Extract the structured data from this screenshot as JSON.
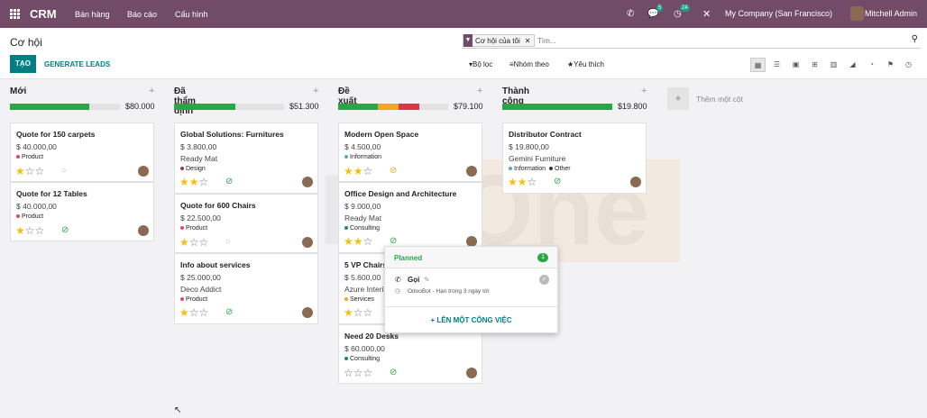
{
  "topbar": {
    "app_name": "CRM",
    "menus": [
      "Bán hàng",
      "Báo cáo",
      "Cấu hình"
    ],
    "messages_count": "5",
    "activities_count": "24",
    "company": "My Company (San Francisco)",
    "user": "Mitchell Admin"
  },
  "control": {
    "title": "Cơ hội",
    "create_label": "TẠO",
    "generate_label": "GENERATE LEADS",
    "facet_label": "Cơ hội của tôi",
    "search_placeholder": "Tìm...",
    "filter_label": "Bộ lọc",
    "group_label": "Nhóm theo",
    "fav_label": "Yêu thích"
  },
  "columns": [
    {
      "title": "Mới",
      "total": "$80.000",
      "progress": [
        {
          "color": "#28a745",
          "pct": 72
        }
      ]
    },
    {
      "title": "Đã thẩm định",
      "total": "$51.300",
      "progress": [
        {
          "color": "#28a745",
          "pct": 56
        }
      ]
    },
    {
      "title": "Đề xuất",
      "total": "$79.100",
      "progress": [
        {
          "color": "#28a745",
          "pct": 36
        },
        {
          "color": "#f0a722",
          "pct": 19
        },
        {
          "color": "#dc3545",
          "pct": 19
        }
      ]
    },
    {
      "title": "Thành công",
      "total": "$19.800",
      "progress": [
        {
          "color": "#28a745",
          "pct": 100
        }
      ]
    }
  ],
  "cards": {
    "c1": {
      "name": "Quote for 150 carpets",
      "amount": "$ 40.000,00",
      "customer": "",
      "tags": [
        "Product"
      ],
      "stars": 1
    },
    "c2": {
      "name": "Quote for 12 Tables",
      "amount": "$ 40.000,00",
      "customer": "",
      "tags": [
        "Product"
      ],
      "stars": 1
    },
    "c3": {
      "name": "Global Solutions: Furnitures",
      "amount": "$ 3.800,00",
      "customer": "Ready Mat",
      "tags": [
        "Design"
      ],
      "stars": 2
    },
    "c4": {
      "name": "Quote for 600 Chairs",
      "amount": "$ 22.500,00",
      "customer": "",
      "tags": [
        "Product"
      ],
      "stars": 1
    },
    "c5": {
      "name": "Info about services",
      "amount": "$ 25.000,00",
      "customer": "Deco Addict",
      "tags": [
        "Product"
      ],
      "stars": 1
    },
    "c6": {
      "name": "Modern Open Space",
      "amount": "$ 4.500,00",
      "customer": "",
      "tags": [
        "Information"
      ],
      "stars": 2
    },
    "c7": {
      "name": "Office Design and Architecture",
      "amount": "$ 9.000,00",
      "customer": "Ready Mat",
      "tags": [
        "Consulting"
      ],
      "stars": 2
    },
    "c8": {
      "name": "5 VP Chairs",
      "amount": "$ 5.600,00",
      "customer": "Azure Interi",
      "tags": [
        "Services"
      ],
      "stars": 1
    },
    "c9": {
      "name": "Need 20 Desks",
      "amount": "$ 60.000,00",
      "customer": "",
      "tags": [
        "Consulting"
      ],
      "stars": 0
    },
    "c10": {
      "name": "Distributor Contract",
      "amount": "$ 19.800,00",
      "customer": "Gemini Furniture",
      "tags": [
        "Information",
        "Other"
      ],
      "stars": 2
    }
  },
  "add_column": "Thêm một cột",
  "popup": {
    "title": "Planned",
    "count": "1",
    "activity": "Gọi",
    "detail": "OdooBot - Hạn trong 3 ngày tới",
    "schedule": "LÊN MỘT CÔNG VIỆC"
  },
  "watermark": "ERPOne"
}
